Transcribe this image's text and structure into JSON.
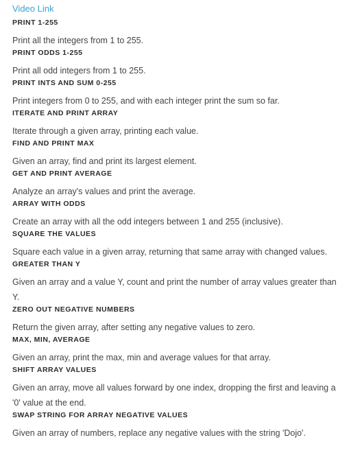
{
  "video_link": "Video Link",
  "exercises": [
    {
      "title": "PRINT 1-255",
      "description": "Print all the integers from 1 to 255."
    },
    {
      "title": "PRINT ODDS 1-255",
      "description": "Print all odd integers from 1 to 255."
    },
    {
      "title": "PRINT INTS AND SUM 0-255",
      "description": "Print integers from 0 to 255, and with each integer print the sum so far."
    },
    {
      "title": "ITERATE AND PRINT ARRAY",
      "description": "Iterate through a given array, printing each value."
    },
    {
      "title": "FIND AND PRINT MAX",
      "description": "Given an array, find and print its largest element."
    },
    {
      "title": "GET AND PRINT AVERAGE",
      "description": "Analyze an array's values and print the average."
    },
    {
      "title": "ARRAY WITH ODDS",
      "description": "Create an array with all the odd integers between 1 and 255 (inclusive)."
    },
    {
      "title": "SQUARE THE VALUES",
      "description": "Square each value in a given array, returning that same array with changed values."
    },
    {
      "title": "GREATER THAN Y",
      "description": "Given an array and a value Y, count and print the number of array values greater than Y."
    },
    {
      "title": "ZERO OUT NEGATIVE NUMBERS",
      "description": "Return the given array, after setting any negative values to zero."
    },
    {
      "title": "MAX, MIN, AVERAGE",
      "description": "Given an array, print the max, min and average values for that array."
    },
    {
      "title": "SHIFT ARRAY VALUES",
      "description": "Given an array, move all values forward by one index, dropping the first and leaving a '0' value at the end."
    },
    {
      "title": "SWAP STRING FOR ARRAY NEGATIVE VALUES",
      "description": "Given an array of numbers, replace any negative values with the string 'Dojo'."
    }
  ]
}
